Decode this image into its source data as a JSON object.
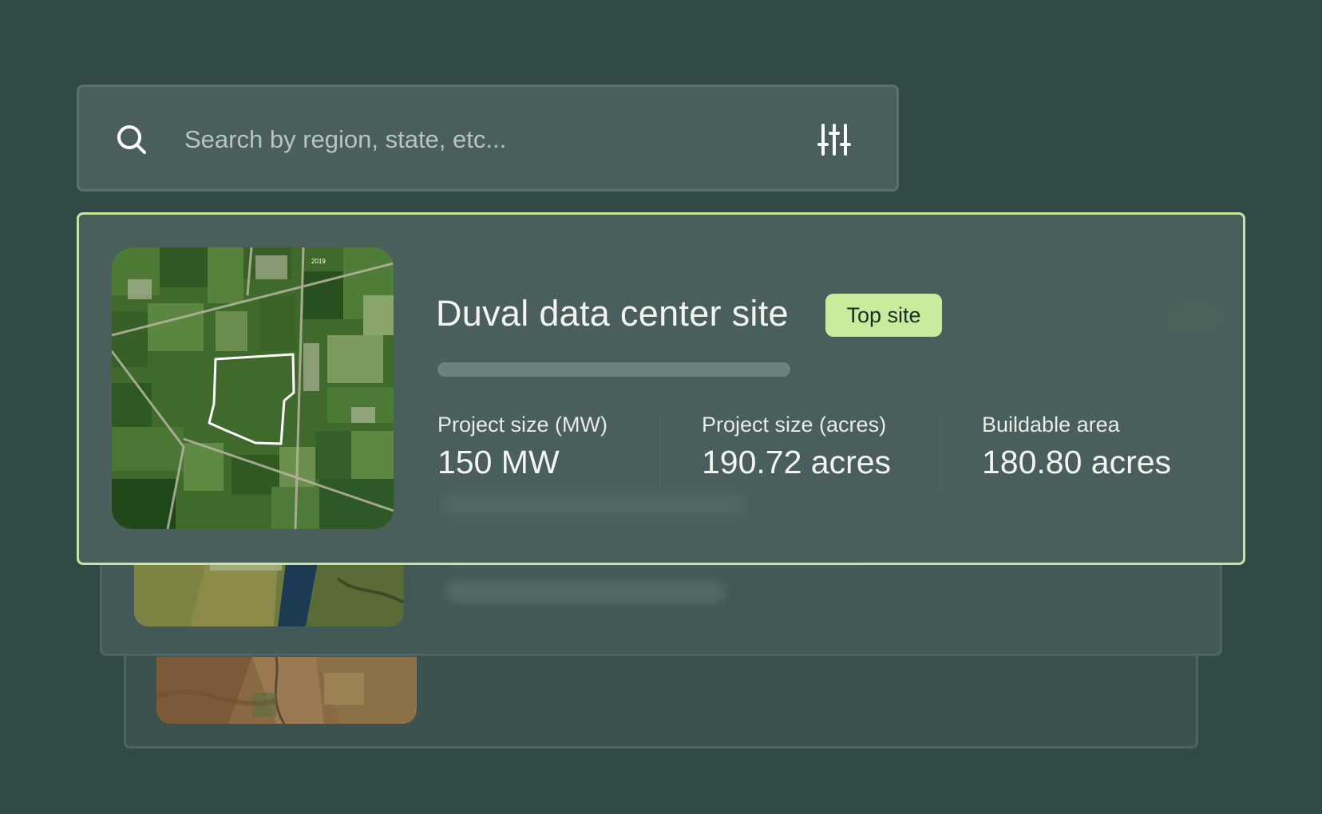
{
  "search": {
    "placeholder": "Search by region, state, etc...",
    "icon": "search-icon",
    "filter_icon": "sliders-icon"
  },
  "site": {
    "title": "Duval data center site",
    "badge": "Top site",
    "map_year_label": "2019",
    "metrics": [
      {
        "label": "Project size (MW)",
        "value": "150 MW"
      },
      {
        "label": "Project size (acres)",
        "value": "190.72 acres"
      },
      {
        "label": "Buildable area",
        "value": "180.80 acres"
      }
    ]
  },
  "colors": {
    "background": "#324a47",
    "card": "#4a5e5b",
    "highlight_border": "#c4e6a2",
    "badge": "#c8eb9e"
  }
}
